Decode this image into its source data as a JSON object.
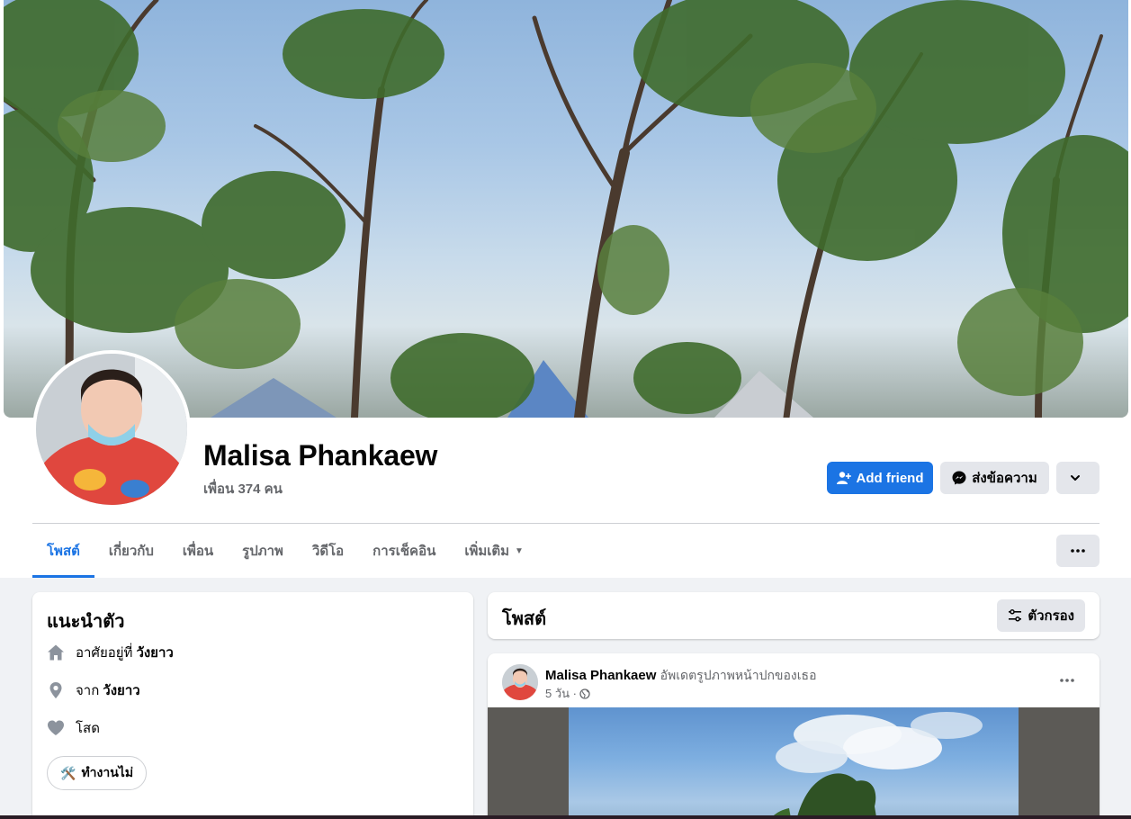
{
  "profile": {
    "name": "Malisa Phankaew",
    "friends_text": "เพื่อน 374 คน"
  },
  "actions": {
    "add_friend": "Add friend",
    "message": "ส่งข้อความ"
  },
  "tabs": [
    {
      "label": "โพสต์",
      "active": true
    },
    {
      "label": "เกี่ยวกับ"
    },
    {
      "label": "เพื่อน"
    },
    {
      "label": "รูปภาพ"
    },
    {
      "label": "วิดีโอ"
    },
    {
      "label": "การเช็คอิน"
    },
    {
      "label": "เพิ่มเติม"
    }
  ],
  "intro": {
    "title": "แนะนำตัว",
    "lives_prefix": "อาศัยอยู่ที่",
    "lives_place": "วังยาว",
    "from_prefix": "จาก",
    "from_place": "วังยาว",
    "relationship": "โสด",
    "work_chip": "ทำงานไม่",
    "work_emoji": "🛠️"
  },
  "posts": {
    "title": "โพสต์",
    "filter_label": "ตัวกรอง"
  },
  "post": {
    "author": "Malisa Phankaew",
    "action": "อัพเดตรูปภาพหน้าปกของเธอ",
    "time": "5 วัน ·"
  },
  "colors": {
    "accent": "#1b74e4",
    "secondary_button": "#e4e6eb",
    "page_background": "#f0f2f5",
    "muted_text": "#65676b"
  }
}
